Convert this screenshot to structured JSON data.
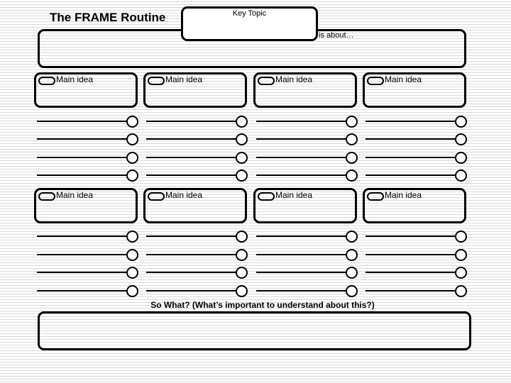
{
  "header": {
    "title": "The FRAME Routine",
    "key_topic_label": "Key Topic",
    "is_about_label": "is about…"
  },
  "main_ideas": {
    "row1": [
      {
        "label": "Main idea",
        "details": [
          "",
          "",
          "",
          ""
        ]
      },
      {
        "label": "Main idea",
        "details": [
          "",
          "",
          "",
          ""
        ]
      },
      {
        "label": "Main idea",
        "details": [
          "",
          "",
          "",
          ""
        ]
      },
      {
        "label": "Main idea",
        "details": [
          "",
          "",
          "",
          ""
        ]
      }
    ],
    "row2": [
      {
        "label": "Main idea",
        "details": [
          "",
          "",
          "",
          ""
        ]
      },
      {
        "label": "Main idea",
        "details": [
          "",
          "",
          "",
          ""
        ]
      },
      {
        "label": "Main idea",
        "details": [
          "",
          "",
          "",
          ""
        ]
      },
      {
        "label": "Main idea",
        "details": [
          "",
          "",
          "",
          ""
        ]
      }
    ]
  },
  "so_what": {
    "label": "So What? (What’s important to understand about this?)"
  }
}
